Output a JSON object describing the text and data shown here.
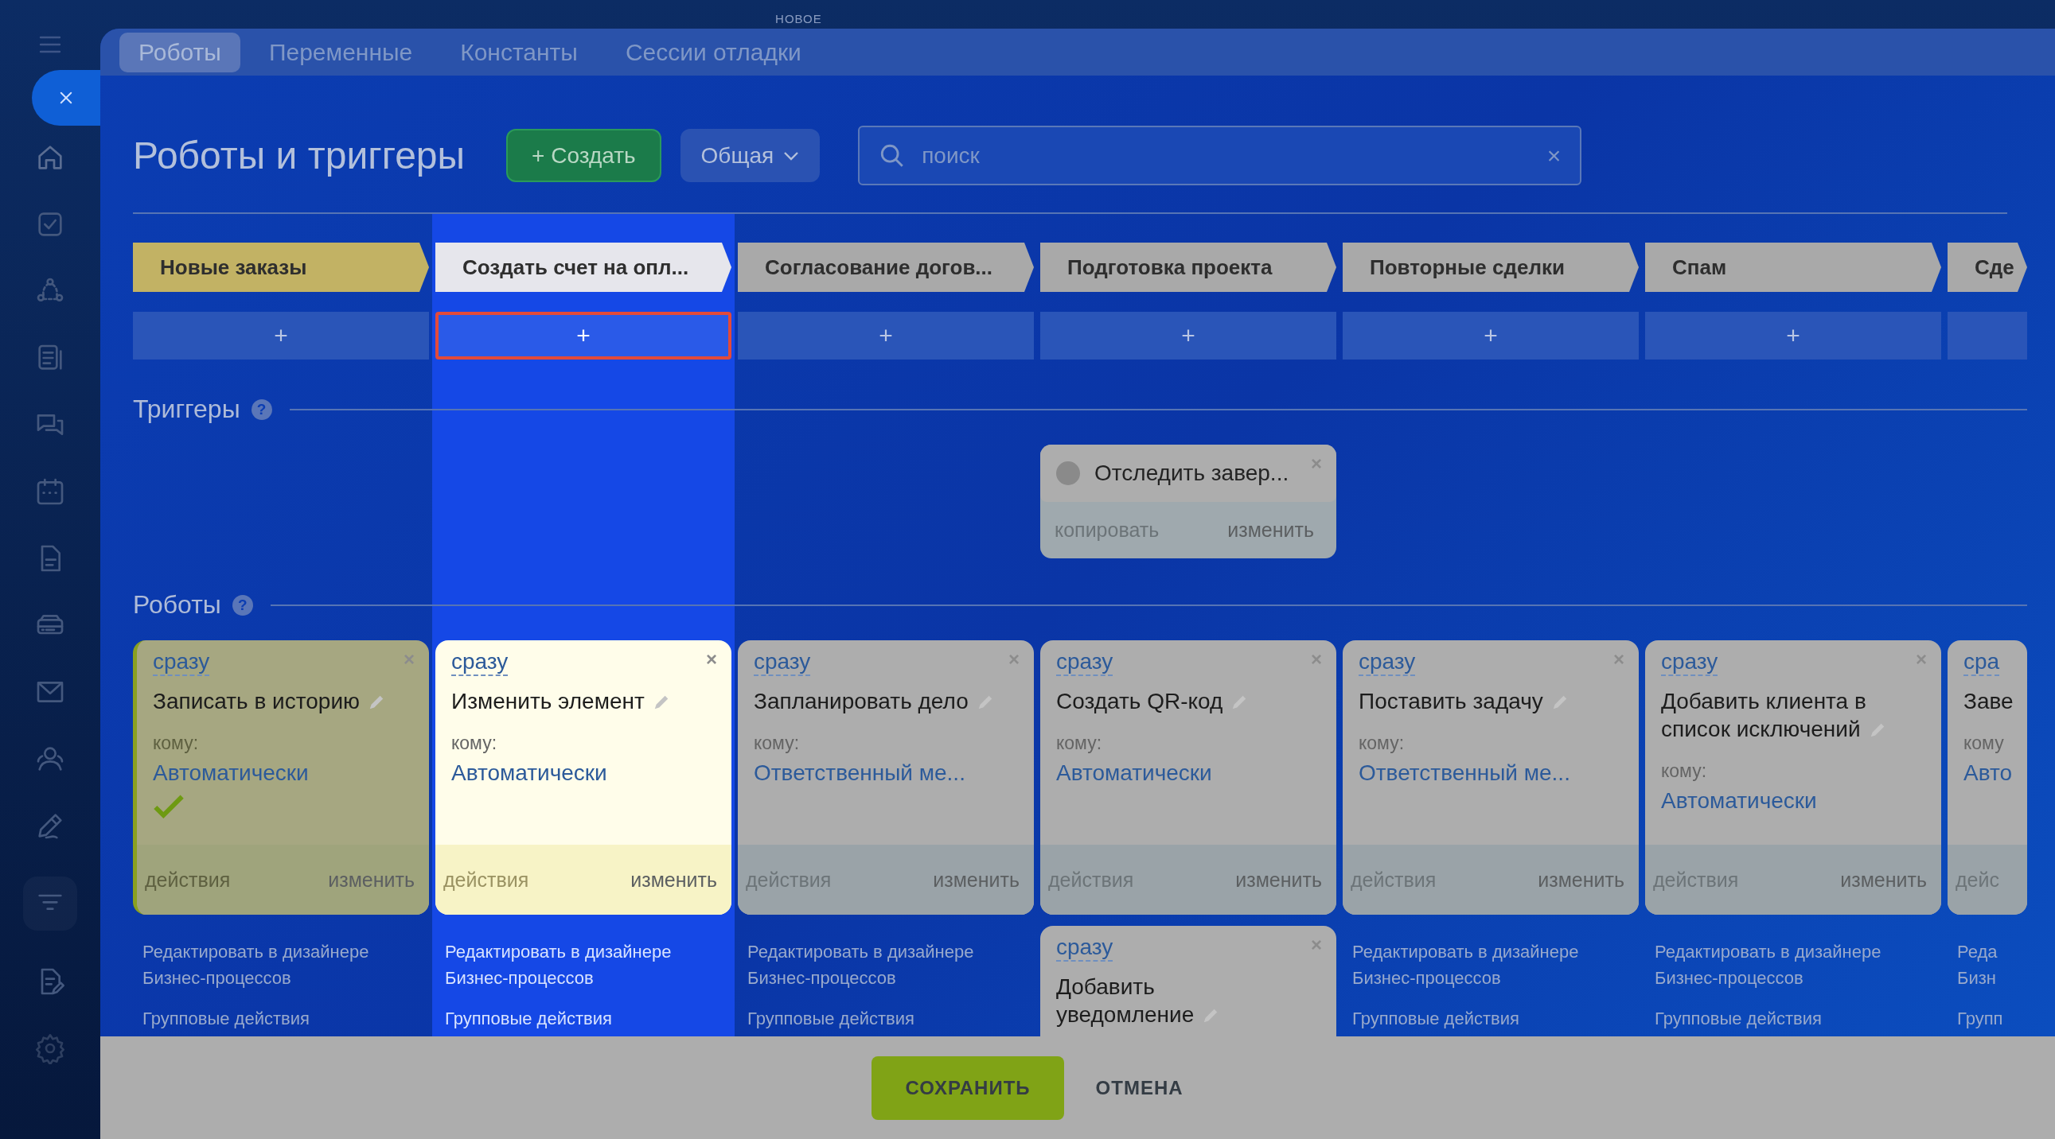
{
  "tabs": [
    {
      "label": "Роботы",
      "selected": true
    },
    {
      "label": "Переменные",
      "selected": false
    },
    {
      "label": "Константы",
      "selected": false
    },
    {
      "label": "Сессии отладки",
      "selected": false,
      "badge": "НОВОЕ"
    }
  ],
  "header": {
    "title": "Роботы и триггеры",
    "create_button": "+ Создать",
    "category": "Общая",
    "search": {
      "placeholder": "поиск",
      "clear": "×"
    }
  },
  "triggers_heading": {
    "label": "Триггеры",
    "help": "?"
  },
  "robots_heading": {
    "label": "Роботы",
    "help": "?"
  },
  "stages": [
    {
      "name": "Новые заказы",
      "color": "#c2b264",
      "highlighted": false,
      "add": "+",
      "robots": [
        {
          "delay": "сразу",
          "title": "Записать в историю",
          "to_label": "кому:",
          "to_value": "Автоматически",
          "done": true,
          "actions_label": "действия",
          "edit_label": "изменить",
          "close": "×"
        }
      ],
      "designer_link": "Редактировать в дизайнере Бизнес-процессов",
      "group_link": "Групповые действия"
    },
    {
      "name": "Создать счет на опл...",
      "color": "#e6e6ec",
      "highlighted": true,
      "add": "+",
      "robots": [
        {
          "delay": "сразу",
          "title": "Изменить элемент",
          "to_label": "кому:",
          "to_value": "Автоматически",
          "done": false,
          "actions_label": "действия",
          "edit_label": "изменить",
          "close": "×"
        }
      ],
      "designer_link": "Редактировать в дизайнере Бизнес-процессов",
      "group_link": "Групповые действия"
    },
    {
      "name": "Согласование догов...",
      "color": "#a9a9a9",
      "highlighted": false,
      "add": "+",
      "robots": [
        {
          "delay": "сразу",
          "title": "Запланировать дело",
          "to_label": "кому:",
          "to_value": "Ответственный ме...",
          "done": false,
          "actions_label": "действия",
          "edit_label": "изменить",
          "close": "×"
        }
      ],
      "designer_link": "Редактировать в дизайнере Бизнес-процессов",
      "group_link": "Групповые действия"
    },
    {
      "name": "Подготовка проекта",
      "color": "#a9a9a9",
      "highlighted": false,
      "add": "+",
      "triggers": [
        {
          "title": "Отследить завер...",
          "close": "×",
          "copy_label": "копировать",
          "edit_label": "изменить"
        }
      ],
      "robots": [
        {
          "delay": "сразу",
          "title": "Создать QR-код",
          "to_label": "кому:",
          "to_value": "Автоматически",
          "done": false,
          "actions_label": "действия",
          "edit_label": "изменить",
          "close": "×"
        },
        {
          "delay": "сразу",
          "title": "Добавить уведомление",
          "done": false,
          "close": "×"
        }
      ]
    },
    {
      "name": "Повторные сделки",
      "color": "#a9a9a9",
      "highlighted": false,
      "add": "+",
      "robots": [
        {
          "delay": "сразу",
          "title": "Поставить задачу",
          "to_label": "кому:",
          "to_value": "Ответственный ме...",
          "done": false,
          "actions_label": "действия",
          "edit_label": "изменить",
          "close": "×"
        }
      ],
      "designer_link": "Редактировать в дизайнере Бизнес-процессов",
      "group_link": "Групповые действия"
    },
    {
      "name": "Спам",
      "color": "#a9a9a9",
      "highlighted": false,
      "add": "+",
      "robots": [
        {
          "delay": "сразу",
          "title": "Добавить клиента в список исключений",
          "to_label": "кому:",
          "to_value": "Автоматически",
          "done": false,
          "actions_label": "действия",
          "edit_label": "изменить",
          "close": "×"
        }
      ],
      "designer_link": "Редактировать в дизайнере Бизнес-процессов",
      "group_link": "Групповые действия"
    },
    {
      "name": "Сде",
      "color": "#a9a9a9",
      "highlighted": false,
      "robots": [
        {
          "delay": "сра",
          "title": "Заве",
          "to_label": "кому",
          "to_value": "Авто",
          "done": false,
          "actions_label": "дейс"
        }
      ],
      "designer_link": "Реда Бизн",
      "group_link": "Групп"
    }
  ],
  "footer": {
    "save": "СОХРАНИТЬ",
    "cancel": "ОТМЕНА"
  }
}
